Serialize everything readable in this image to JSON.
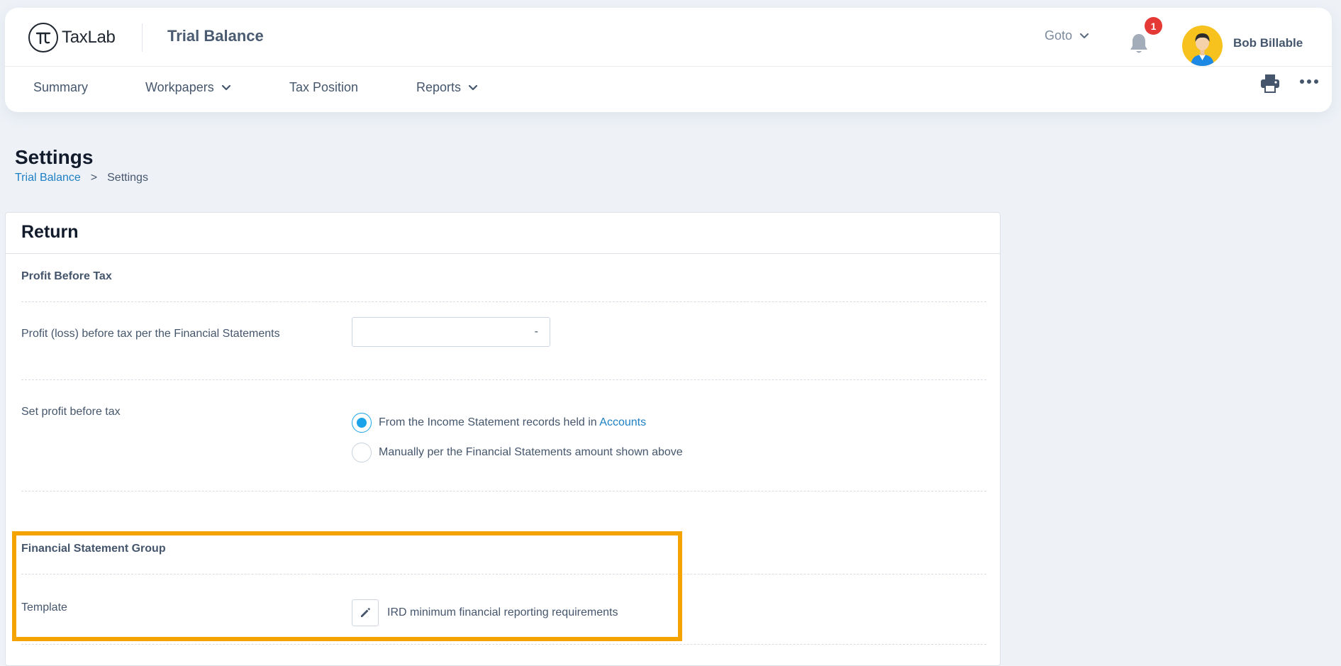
{
  "header": {
    "logo_text": "TaxLab",
    "page_name": "Trial Balance",
    "goto_label": "Goto",
    "notification_count": "1",
    "user_name": "Bob Billable"
  },
  "nav": {
    "items": [
      {
        "label": "Summary"
      },
      {
        "label": "Workpapers"
      },
      {
        "label": "Tax Position"
      },
      {
        "label": "Reports"
      }
    ]
  },
  "page": {
    "title": "Settings",
    "breadcrumb": {
      "parent": "Trial Balance",
      "separator": ">",
      "current": "Settings"
    }
  },
  "return_card": {
    "title": "Return",
    "profit_section": {
      "heading": "Profit Before Tax",
      "profit_label": "Profit (loss) before tax per the Financial Statements",
      "profit_value": "-",
      "set_profit_label": "Set profit before tax",
      "option_income_text": "From the Income Statement records held in ",
      "option_income_link": "Accounts",
      "option_manual_text": "Manually per the Financial Statements amount shown above",
      "selected_option": "income_statement"
    },
    "fs_group": {
      "heading": "Financial Statement Group",
      "template_label": "Template",
      "template_value": "IRD minimum financial reporting requirements"
    }
  },
  "colors": {
    "accent": "#1aa3e8",
    "link": "#1d7fc4",
    "highlight": "#f5a300",
    "badge": "#e53935"
  }
}
